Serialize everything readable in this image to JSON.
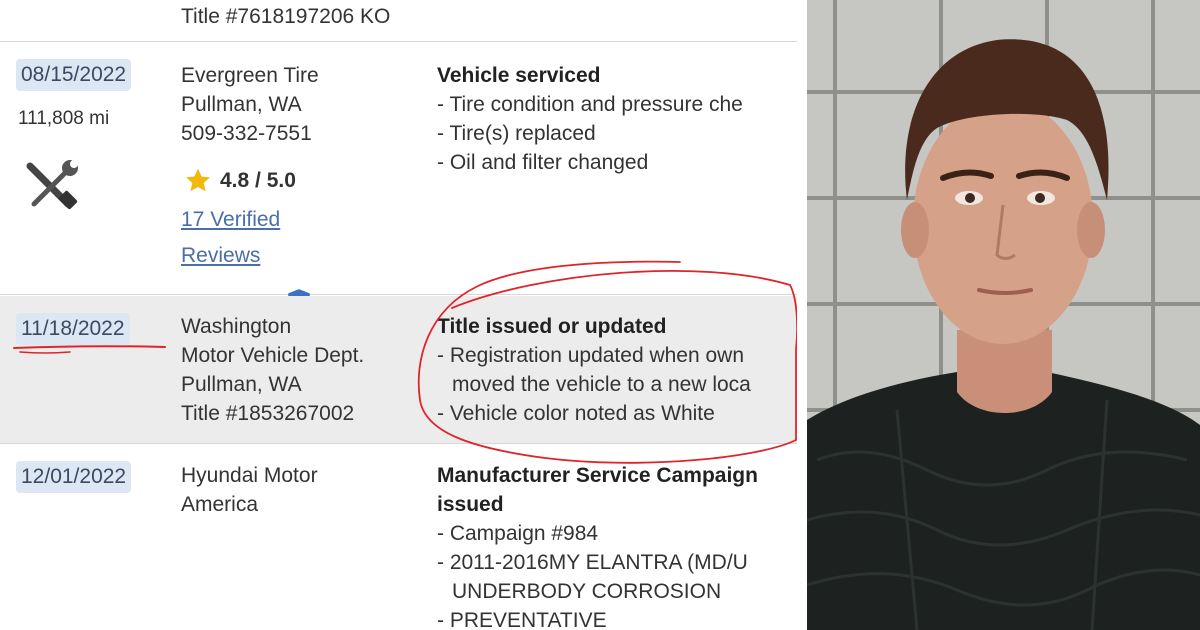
{
  "report": {
    "top_row": {
      "title_number": "Title #7618197206 KO"
    },
    "entries": [
      {
        "date": "08/15/2022",
        "mileage": "111,808 mi",
        "source": [
          "Evergreen Tire",
          "Pullman, WA",
          "509-332-7551"
        ],
        "rating": "4.8 / 5.0",
        "reviews_link_line1": "17 Verified",
        "reviews_link_line2": "Reviews",
        "heading": "Vehicle serviced",
        "details": [
          "- Tire condition and pressure che",
          "- Tire(s) replaced",
          "- Oil and filter changed"
        ],
        "icon": "service-tools-icon"
      },
      {
        "date": "11/18/2022",
        "source": [
          "Washington",
          "Motor Vehicle Dept.",
          "Pullman, WA",
          "Title #1853267002"
        ],
        "heading": "Title issued or updated",
        "details": [
          "- Registration updated when own",
          "moved the vehicle to a new loca",
          "- Vehicle color noted as White"
        ]
      },
      {
        "date": "12/01/2022",
        "source": [
          "Hyundai Motor",
          "America"
        ],
        "heading": [
          "Manufacturer Service Campaign",
          "issued"
        ],
        "details": [
          "- Campaign #984",
          "- 2011-2016MY ELANTRA (MD/U",
          "UNDERBODY CORROSION",
          "- PREVENTATIVE"
        ]
      }
    ],
    "colors": {
      "date_badge": "#dde6f3",
      "highlight_row": "#ececec",
      "link": "#4a6ea8",
      "annotation": "#e0242b",
      "star": "#f2b90c"
    }
  },
  "photo": {
    "subject": "portrait photo against a gray tiled wall"
  }
}
